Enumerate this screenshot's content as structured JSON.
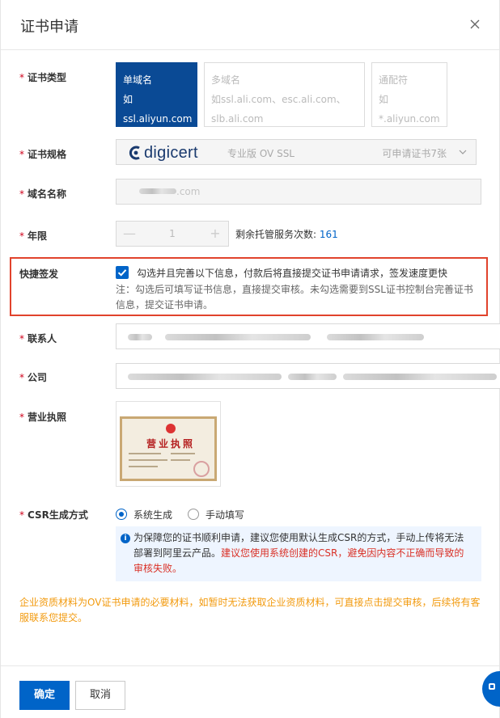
{
  "dialog": {
    "title": "证书申请"
  },
  "labels": {
    "cert_type": "证书类型",
    "cert_spec": "证书规格",
    "domain": "域名名称",
    "years": "年限",
    "fast_sign": "快捷签发",
    "contact": "联系人",
    "company": "公司",
    "license": "营业执照",
    "csr": "CSR生成方式",
    "required_mark": "*"
  },
  "cert_types": [
    {
      "name": "单域名",
      "example": "如ssl.aliyun.com",
      "selected": true
    },
    {
      "name": "多域名",
      "example": "如ssl.ali.com、esc.ali.com、slb.ali.com",
      "example_line1": "如ssl.ali.com、esc.ali.com、",
      "example_line2": "slb.ali.com",
      "selected": false
    },
    {
      "name": "通配符",
      "example": "如*.aliyun.com",
      "selected": false
    }
  ],
  "cert_spec": {
    "brand": "digicert",
    "product": "专业版 OV SSL",
    "available": "可申请证书7张"
  },
  "domain": {
    "value": ".com"
  },
  "years": {
    "value": "1",
    "minus": "—",
    "plus": "+"
  },
  "quota": {
    "label": "剩余托管服务次数:",
    "count": "161"
  },
  "fast_sign": {
    "checked": true,
    "text": "勾选并且完善以下信息，付款后将直接提交证书申请请求，签发速度更快",
    "note": "注：勾选后可填写证书信息，直接提交审核。未勾选需要到SSL证书控制台完善证书信息，提交证书申请。"
  },
  "license_image": {
    "title": "营业执照"
  },
  "csr": {
    "options": [
      {
        "label": "系统生成",
        "checked": true
      },
      {
        "label": "手动填写",
        "checked": false
      }
    ],
    "info": "为保障您的证书顺利申请，建议您使用默认生成CSR的方式，手动上传将无法部署到阿里云产品。",
    "warning": "建议您使用系统创建的CSR，避免因内容不正确而导致的审核失败。"
  },
  "notice": "企业资质材料为OV证书申请的必要材料，如暂时无法获取企业资质材料，可直接点击提交审核，后续将有客服联系您提交。",
  "footer": {
    "confirm": "确定",
    "cancel": "取消"
  },
  "colors": {
    "primary": "#0064c8",
    "selected_card": "#0a4a95",
    "highlight": "#e1432c",
    "warn": "#d93026",
    "notice": "#f29a0e"
  }
}
